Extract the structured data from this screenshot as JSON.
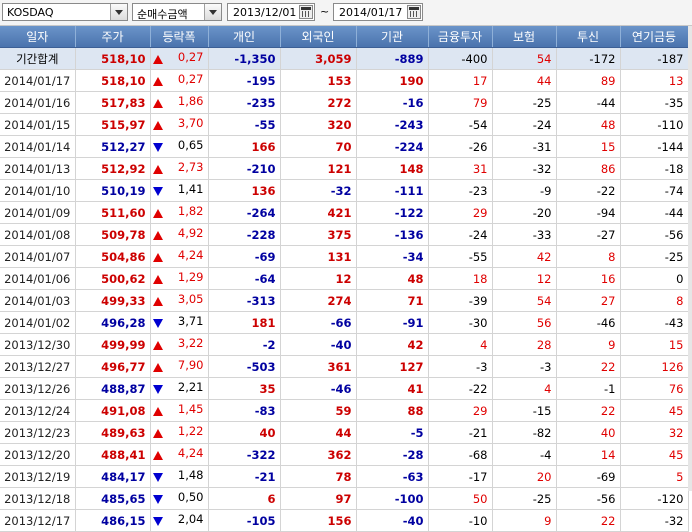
{
  "toolbar": {
    "market": "KOSDAQ",
    "metric": "순매수금액",
    "date_from": "2013/12/01",
    "separator": "~",
    "date_to": "2014/01/17"
  },
  "columns": [
    "일자",
    "주가",
    "등락폭",
    "개인",
    "외국인",
    "기관",
    "금융투자",
    "보험",
    "투신",
    "연기금등"
  ],
  "rows": [
    {
      "date": "기간합계",
      "price": "518,10",
      "dir": "up",
      "chg": "0,27",
      "indiv": "-1,350",
      "foreign": "3,059",
      "inst": "-889",
      "fin": "-400",
      "ins": "54",
      "trust": "-172",
      "pension": "-187",
      "total": true
    },
    {
      "date": "2014/01/17",
      "price": "518,10",
      "dir": "up",
      "chg": "0,27",
      "indiv": "-195",
      "foreign": "153",
      "inst": "190",
      "fin": "17",
      "ins": "44",
      "trust": "89",
      "pension": "13"
    },
    {
      "date": "2014/01/16",
      "price": "517,83",
      "dir": "up",
      "chg": "1,86",
      "indiv": "-235",
      "foreign": "272",
      "inst": "-16",
      "fin": "79",
      "ins": "-25",
      "trust": "-44",
      "pension": "-35"
    },
    {
      "date": "2014/01/15",
      "price": "515,97",
      "dir": "up",
      "chg": "3,70",
      "indiv": "-55",
      "foreign": "320",
      "inst": "-243",
      "fin": "-54",
      "ins": "-24",
      "trust": "48",
      "pension": "-110"
    },
    {
      "date": "2014/01/14",
      "price": "512,27",
      "dir": "down",
      "chg": "0,65",
      "indiv": "166",
      "foreign": "70",
      "inst": "-224",
      "fin": "-26",
      "ins": "-31",
      "trust": "15",
      "pension": "-144"
    },
    {
      "date": "2014/01/13",
      "price": "512,92",
      "dir": "up",
      "chg": "2,73",
      "indiv": "-210",
      "foreign": "121",
      "inst": "148",
      "fin": "31",
      "ins": "-32",
      "trust": "86",
      "pension": "-18"
    },
    {
      "date": "2014/01/10",
      "price": "510,19",
      "dir": "down",
      "chg": "1,41",
      "indiv": "136",
      "foreign": "-32",
      "inst": "-111",
      "fin": "-23",
      "ins": "-9",
      "trust": "-22",
      "pension": "-74"
    },
    {
      "date": "2014/01/09",
      "price": "511,60",
      "dir": "up",
      "chg": "1,82",
      "indiv": "-264",
      "foreign": "421",
      "inst": "-122",
      "fin": "29",
      "ins": "-20",
      "trust": "-94",
      "pension": "-44"
    },
    {
      "date": "2014/01/08",
      "price": "509,78",
      "dir": "up",
      "chg": "4,92",
      "indiv": "-228",
      "foreign": "375",
      "inst": "-136",
      "fin": "-24",
      "ins": "-33",
      "trust": "-27",
      "pension": "-56"
    },
    {
      "date": "2014/01/07",
      "price": "504,86",
      "dir": "up",
      "chg": "4,24",
      "indiv": "-69",
      "foreign": "131",
      "inst": "-34",
      "fin": "-55",
      "ins": "42",
      "trust": "8",
      "pension": "-25"
    },
    {
      "date": "2014/01/06",
      "price": "500,62",
      "dir": "up",
      "chg": "1,29",
      "indiv": "-64",
      "foreign": "12",
      "inst": "48",
      "fin": "18",
      "ins": "12",
      "trust": "16",
      "pension": "0"
    },
    {
      "date": "2014/01/03",
      "price": "499,33",
      "dir": "up",
      "chg": "3,05",
      "indiv": "-313",
      "foreign": "274",
      "inst": "71",
      "fin": "-39",
      "ins": "54",
      "trust": "27",
      "pension": "8"
    },
    {
      "date": "2014/01/02",
      "price": "496,28",
      "dir": "down",
      "chg": "3,71",
      "indiv": "181",
      "foreign": "-66",
      "inst": "-91",
      "fin": "-30",
      "ins": "56",
      "trust": "-46",
      "pension": "-43"
    },
    {
      "date": "2013/12/30",
      "price": "499,99",
      "dir": "up",
      "chg": "3,22",
      "indiv": "-2",
      "foreign": "-40",
      "inst": "42",
      "fin": "4",
      "ins": "28",
      "trust": "9",
      "pension": "15"
    },
    {
      "date": "2013/12/27",
      "price": "496,77",
      "dir": "up",
      "chg": "7,90",
      "indiv": "-503",
      "foreign": "361",
      "inst": "127",
      "fin": "-3",
      "ins": "-3",
      "trust": "22",
      "pension": "126"
    },
    {
      "date": "2013/12/26",
      "price": "488,87",
      "dir": "down",
      "chg": "2,21",
      "indiv": "35",
      "foreign": "-46",
      "inst": "41",
      "fin": "-22",
      "ins": "4",
      "trust": "-1",
      "pension": "76"
    },
    {
      "date": "2013/12/24",
      "price": "491,08",
      "dir": "up",
      "chg": "1,45",
      "indiv": "-83",
      "foreign": "59",
      "inst": "88",
      "fin": "29",
      "ins": "-15",
      "trust": "22",
      "pension": "45"
    },
    {
      "date": "2013/12/23",
      "price": "489,63",
      "dir": "up",
      "chg": "1,22",
      "indiv": "40",
      "foreign": "44",
      "inst": "-5",
      "fin": "-21",
      "ins": "-82",
      "trust": "40",
      "pension": "32"
    },
    {
      "date": "2013/12/20",
      "price": "488,41",
      "dir": "up",
      "chg": "4,24",
      "indiv": "-322",
      "foreign": "362",
      "inst": "-28",
      "fin": "-68",
      "ins": "-4",
      "trust": "14",
      "pension": "45"
    },
    {
      "date": "2013/12/19",
      "price": "484,17",
      "dir": "down",
      "chg": "1,48",
      "indiv": "-21",
      "foreign": "78",
      "inst": "-63",
      "fin": "-17",
      "ins": "20",
      "trust": "-69",
      "pension": "5"
    },
    {
      "date": "2013/12/18",
      "price": "485,65",
      "dir": "down",
      "chg": "0,50",
      "indiv": "6",
      "foreign": "97",
      "inst": "-100",
      "fin": "50",
      "ins": "-25",
      "trust": "-56",
      "pension": "-120"
    },
    {
      "date": "2013/12/17",
      "price": "486,15",
      "dir": "down",
      "chg": "2,04",
      "indiv": "-105",
      "foreign": "156",
      "inst": "-40",
      "fin": "-10",
      "ins": "9",
      "trust": "22",
      "pension": "-32"
    }
  ],
  "colors": {
    "up": "#e00000",
    "down": "#0000c0",
    "header": "#5a82bb",
    "total_row": "#dde6f2"
  },
  "icons": {
    "up": "triangle-up-icon",
    "down": "triangle-down-icon",
    "dropdown": "chevron-down-icon",
    "calendar": "calendar-icon"
  }
}
